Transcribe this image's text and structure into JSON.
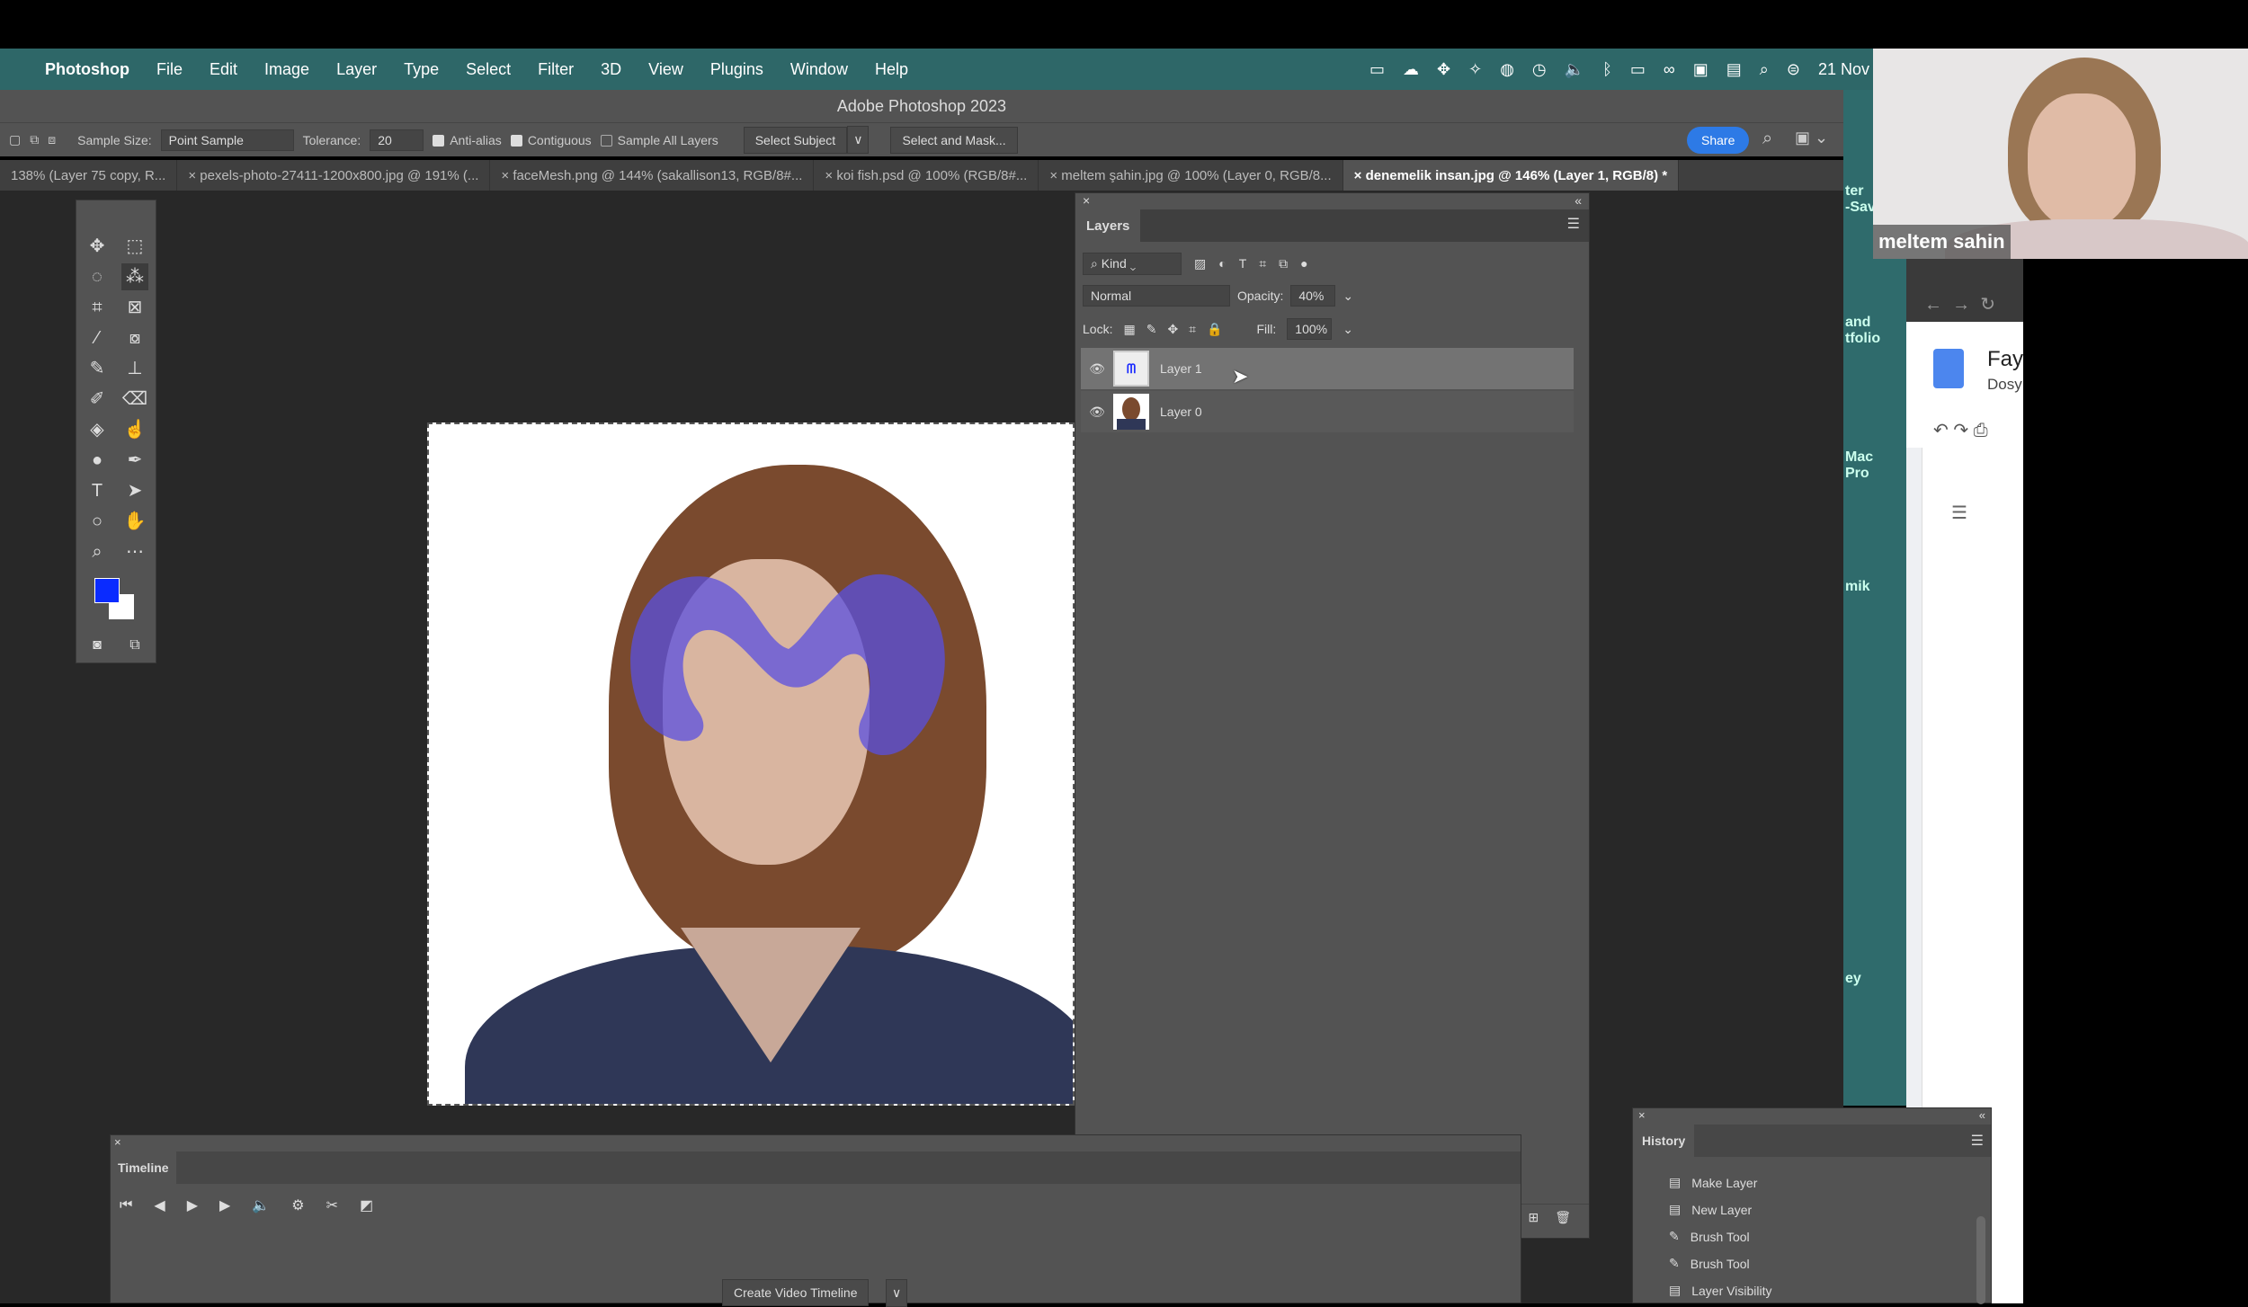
{
  "menubar": {
    "app": "Photoshop",
    "items": [
      "File",
      "Edit",
      "Image",
      "Layer",
      "Type",
      "Select",
      "Filter",
      "3D",
      "View",
      "Plugins",
      "Window",
      "Help"
    ],
    "date": "21 Nov"
  },
  "window": {
    "title": "Adobe Photoshop 2023"
  },
  "options": {
    "sample_size_label": "Sample Size:",
    "sample_size": "Point Sample",
    "tolerance_label": "Tolerance:",
    "tolerance": "20",
    "anti_alias": "Anti-alias",
    "anti_alias_checked": true,
    "contiguous": "Contiguous",
    "contiguous_checked": true,
    "sample_all": "Sample All Layers",
    "sample_all_checked": false,
    "select_subject": "Select Subject",
    "select_mask": "Select and Mask...",
    "share": "Share"
  },
  "tabs": [
    "138% (Layer 75 copy, R...",
    "pexels-photo-27411-1200x800.jpg @ 191% (...",
    "faceMesh.png @ 144% (sakallison13, RGB/8#...",
    "koi fish.psd @ 100% (RGB/8#...",
    "meltem şahin.jpg @ 100% (Layer 0, RGB/8...",
    "denemelik insan.jpg @ 146% (Layer 1, RGB/8) *"
  ],
  "layers": {
    "title": "Layers",
    "kind": "Kind",
    "blend": "Normal",
    "opacity_label": "Opacity:",
    "opacity": "40%",
    "lock_label": "Lock:",
    "fill_label": "Fill:",
    "fill": "100%",
    "items": [
      {
        "name": "Layer 1",
        "selected": true,
        "visible": true
      },
      {
        "name": "Layer 0",
        "selected": false,
        "visible": true
      }
    ]
  },
  "timeline": {
    "title": "Timeline",
    "create": "Create Video Timeline"
  },
  "history": {
    "title": "History",
    "items": [
      "Make Layer",
      "New Layer",
      "Brush Tool",
      "Brush Tool",
      "Layer Visibility"
    ]
  },
  "video": {
    "name": "meltem sahin"
  },
  "desktop": {
    "labels": [
      "ter\n-Save",
      "and\ntfolio",
      "Mac\nPro",
      "mik",
      "ey"
    ]
  },
  "docs": {
    "title": "Fay",
    "menu": "Dosy"
  },
  "colors": {
    "menubar": "#2e6768",
    "foreground": "#0a2bff",
    "share": "#2d7ae6",
    "brush": "#5a50e0"
  }
}
